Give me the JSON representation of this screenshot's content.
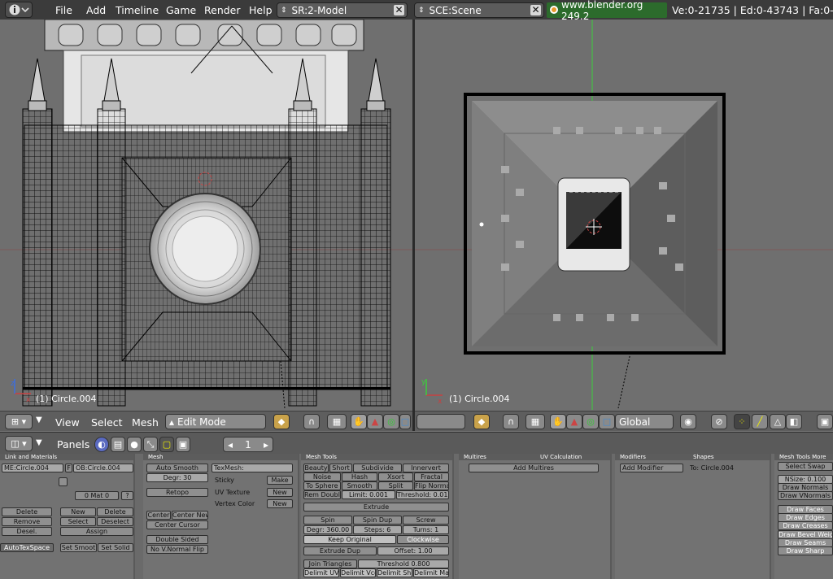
{
  "top_menu": {
    "items": [
      "File",
      "Add",
      "Timeline",
      "Game",
      "Render",
      "Help"
    ],
    "screen_select": "SR:2-Model",
    "scene_select": "SCE:Scene",
    "url": "www.blender.org 249.2",
    "stats": "Ve:0-21735 | Ed:0-43743 | Fa:0-"
  },
  "viewport_left": {
    "object_label": "(1) Circle.004"
  },
  "viewport_right": {
    "object_label": "(1) Circle.004"
  },
  "header_left": {
    "view": "View",
    "select": "Select",
    "mesh": "Mesh",
    "mode": "Edit Mode"
  },
  "header_right": {
    "orientation": "Global"
  },
  "buttons_header": {
    "panels": "Panels",
    "frame": "1"
  },
  "link_materials": {
    "title": "Link and Materials",
    "me_field": "ME:Circle.004",
    "f_label": "F",
    "ob_field": "OB:Circle.004",
    "mat_field": "0 Mat 0",
    "q": "?",
    "delete1": "Delete",
    "new": "New",
    "delete2": "Delete",
    "remove": "Remove",
    "select": "Select",
    "deselect": "Deselect",
    "desel": "Desel.",
    "assign": "Assign",
    "autotex": "AutoTexSpace",
    "set_smooth": "Set Smoot",
    "set_solid": "Set Solid"
  },
  "mesh_panel": {
    "title": "Mesh",
    "auto_smooth": "Auto Smooth",
    "degr": "Degr: 30",
    "retopo": "Retopo",
    "center": "Center",
    "center_new": "Center New",
    "center_cursor": "Center Cursor",
    "double_sided": "Double Sided",
    "no_vnormal_flip": "No V.Normal Flip",
    "texmesh": "TexMesh:",
    "sticky": "Sticky",
    "make": "Make",
    "uv_texture": "UV Texture",
    "new1": "New",
    "vertex_color": "Vertex Color",
    "new2": "New"
  },
  "mesh_tools": {
    "title": "Mesh Tools",
    "row1": [
      "Beauty",
      "Short",
      "Subdivide",
      "Innervert"
    ],
    "row2": [
      "Noise",
      "Hash",
      "Xsort",
      "Fractal"
    ],
    "row3": [
      "To Sphere",
      "Smooth",
      "Split",
      "Flip Normal"
    ],
    "rem_doubl": "Rem Doubl",
    "limit": "Limit: 0.001",
    "threshold": "Threshold: 0.010",
    "extrude": "Extrude",
    "spin": "Spin",
    "spin_dup": "Spin Dup",
    "screw": "Screw",
    "degr": "Degr: 360.00",
    "steps": "Steps: 6",
    "turns": "Turns: 1",
    "keep_original": "Keep Original",
    "clockwise": "Clockwise",
    "extrude_dup": "Extrude Dup",
    "offset": "Offset: 1.00",
    "join_triangles": "Join Triangles",
    "threshold2": "Threshold 0.800",
    "row_last": [
      "Delimit UV",
      "Delimit Vco",
      "Delimit Sha",
      "Delimit Ma"
    ]
  },
  "multires": {
    "title": "Multires",
    "title2": "UV Calculation",
    "add": "Add Multires"
  },
  "modifiers": {
    "title": "Modifiers",
    "title2": "Shapes",
    "add": "Add Modifier",
    "to": "To: Circle.004"
  },
  "mesh_tools_more": {
    "title": "Mesh Tools More",
    "select_swap": "Select Swap",
    "nsize": "NSize: 0.100",
    "draw_normals": "Draw Normals",
    "draw_vnormals": "Draw VNormals",
    "draw_faces": "Draw Faces",
    "draw_edges": "Draw Edges",
    "draw_creases": "Draw Creases",
    "draw_bevel": "Draw Bevel Weigh",
    "draw_seams": "Draw Seams",
    "draw_sharp": "Draw Sharp"
  },
  "colors": {
    "topbar": "#3b3b3b",
    "viewport": "#6f6f6f",
    "url_bg": "#2c6b2c",
    "axis_green": "#3ccf3c",
    "axis_red": "#c84040"
  }
}
